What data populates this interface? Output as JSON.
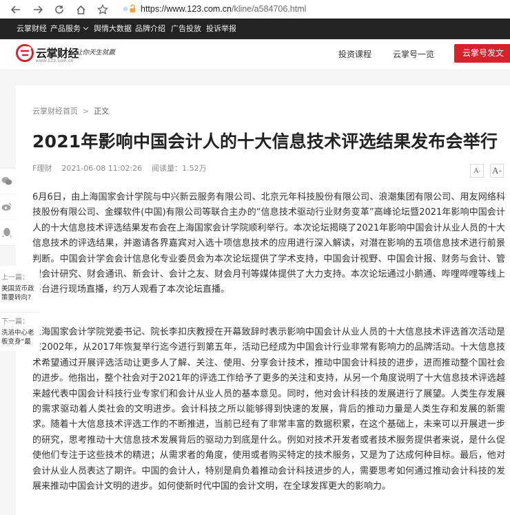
{
  "browser": {
    "url_host": "https://www.123.com.cn",
    "url_path": "/kline/a584706.html"
  },
  "topbar": {
    "items": [
      "云掌财经",
      "产品服务",
      "舆情大数据",
      "品牌介绍",
      "广告投放",
      "投诉举报"
    ]
  },
  "header": {
    "logo_name": "云掌财经",
    "logo_domain": "www.123.com.cn",
    "logo_slogan": "让你天生就赢",
    "links": [
      "投资课程",
      "云掌号一览"
    ],
    "cta_label": "云掌号发文"
  },
  "article": {
    "breadcrumb_home": "云掌财经首页",
    "breadcrumb_sep": ">",
    "breadcrumb_current": "正文",
    "title": "2021年影响中国会计人的十大信息技术评选结果发布会举行",
    "author": "F理财",
    "date": "2021-06-08 11:02:26",
    "views": "阅读量：1.52万",
    "font_smaller": "A",
    "font_larger": "A",
    "paragraphs": [
      "6月6日，由上海国家会计学院与中兴新云服务有限公司、北京元年科技股份有限公司、浪潮集团有限公司、用友网络科技股份有限公司、金蝶软件(中国)有限公司等联合主办的“信息技术驱动行业财务变革”高峰论坛暨2021年影响中国会计人的十大信息技术评选结果发布会在上海国家会计学院顺利举行。本次论坛揭晓了2021年影响中国会计从业人员的十大信息技术的评选结果，并邀请各界嘉宾对入选十项信息技术的应用进行深入解读，对潜在影响的五项信息技术进行前景判断。中国会计学会会计信息化专业委员会为本次论坛提供了学术支持，中国会计视野、中国会计报、财务与会计、管理会计研究、财会通讯、新会计、会计之友、财会月刊等媒体提供了大力支持。本次论坛通过小鹅通、哔哩哔哩等线上平台进行现场直播，约万人观看了本次论坛直播。",
      "上海国家会计学院党委书记、院长李扣庆教授在开幕致辞时表示影响中国会计从业人员的十大信息技术评选首次活动是在2002年，从2017年恢复举行迄今进行到第五年，活动已经成为中国会计行业非常有影响力的品牌活动。十大信息技术希望通过开展评选活动让更多人了解、关注、使用、分享会计技术，推动中国会计科技的进步，进而推动整个国社会的进步。他指出，整个社会对于2021年的评选工作给予了更多的关注和支持，从另一个角度说明了十大信息技术评选越来越代表中国会计科技行业专家们和会计从业人员的基本意见。同时，他对会计科技的发展进行了展望。人类生存发展的需求驱动着人类社会的文明进步。会计科技之所以能够得到快速的发展，背后的推动力量是人类生存和发展的新需求。随着十大信息技术评选工作的不断推进，当前已经有了非常丰富的数据积累，在这个基础上，未来可以开展进一步的研究，思考推动十大信息技术发展背后的驱动力到底是什么。例如对技术开发者或者技术服务提供者来说，是什么促使他们专注于这些技术的精进；从需求者的角度，使用或者购买特定的技术服务，又是为了达成何种目标。最后，他对会计从业人员表达了期许。中国的会计人，特别是肩负着推动会计科技进步的人，需要思考如何通过推动会计科技的发展来推动中国会计文明的进步。如何使新时代中国的会计文明，在全球发挥更大的影响力。"
    ]
  },
  "share": {
    "items": [
      "微信",
      "微博",
      "QQ"
    ]
  },
  "prevnext": {
    "prev_label": "上一篇：",
    "prev_title": "美国货币政策要转向?",
    "next_label": "下一篇：",
    "next_title": "洗浴中心老板变身“最"
  }
}
